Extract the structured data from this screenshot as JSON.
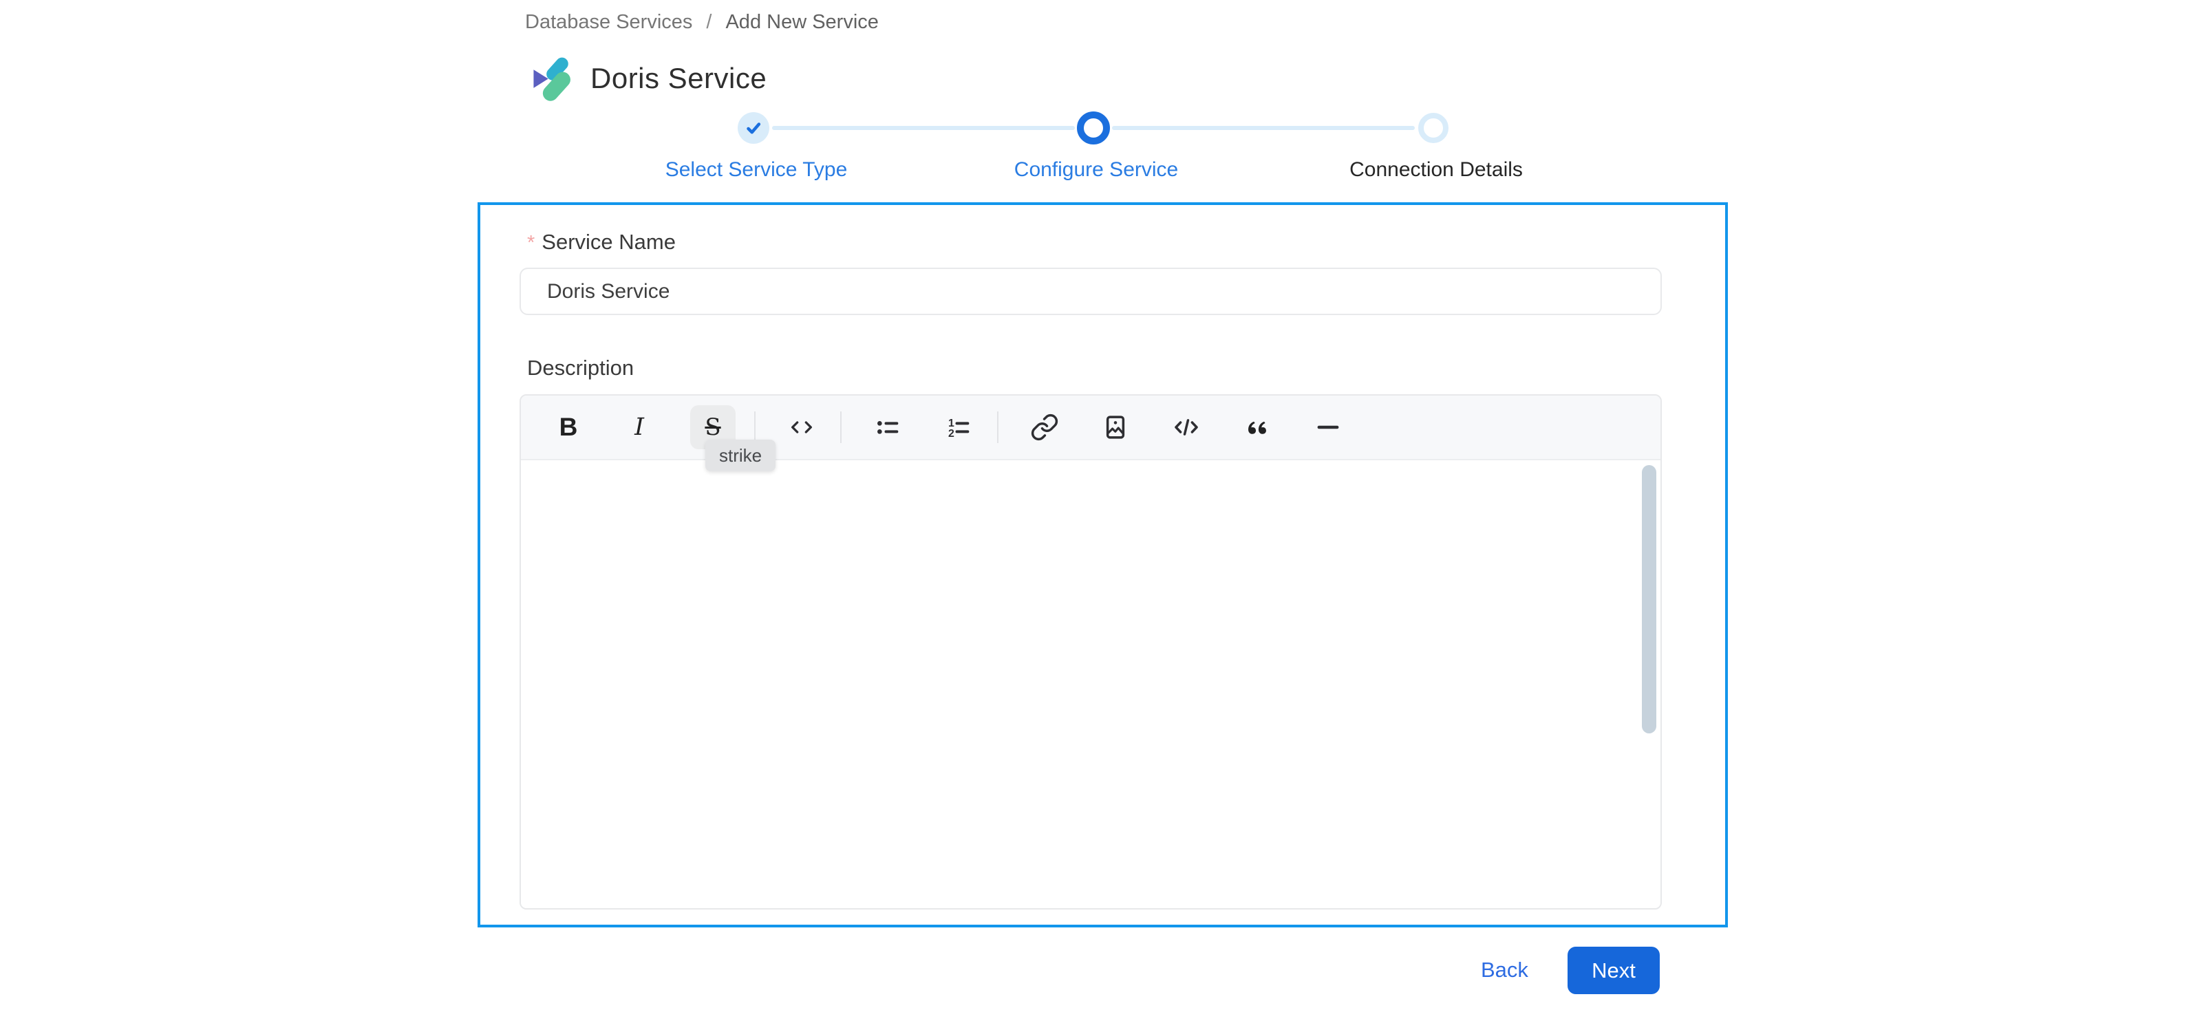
{
  "breadcrumb": {
    "items": [
      "Database Services",
      "Add New Service"
    ],
    "separator": "/"
  },
  "header": {
    "title": "Doris Service",
    "logo_icon": "doris-logo-icon"
  },
  "stepper": {
    "steps": [
      {
        "label": "Select Service Type",
        "state": "completed",
        "icon": "check-icon"
      },
      {
        "label": "Configure Service",
        "state": "active"
      },
      {
        "label": "Connection Details",
        "state": "pending"
      }
    ]
  },
  "form": {
    "service_name": {
      "required_marker": "*",
      "label": "Service Name",
      "value": "Doris Service"
    },
    "description": {
      "label": "Description",
      "content": "",
      "toolbar": {
        "buttons": [
          "bold",
          "italic",
          "strike",
          "inline-code",
          "unordered-list",
          "ordered-list",
          "link",
          "image",
          "code-block",
          "quote",
          "horizontal-rule"
        ],
        "bold_glyph": "B",
        "italic_glyph": "I",
        "strike_glyph": "S",
        "active_button": "strike",
        "tooltip": "strike",
        "ordered_list_digits": {
          "first": "1",
          "second": "2"
        }
      }
    }
  },
  "actions": {
    "back_label": "Back",
    "next_label": "Next"
  },
  "colors": {
    "primary_blue": "#1667da",
    "card_border_blue": "#1296ec",
    "step_active_blue": "#1b6fde",
    "step_light_blue": "#d9ecfa",
    "step_label_blue": "#2a7ce2",
    "toolbar_bg": "#f7f8fa",
    "tooltip_bg": "#e3e4e6",
    "scrollbar": "#c6d2dc",
    "required_red": "#f3a5a5"
  }
}
